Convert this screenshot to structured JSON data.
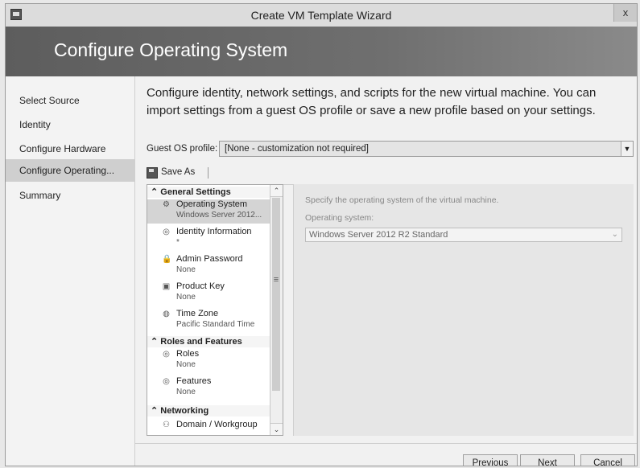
{
  "window": {
    "title": "Create VM Template Wizard",
    "close_glyph": "x"
  },
  "banner": {
    "title": "Configure Operating System"
  },
  "nav": {
    "items": [
      {
        "label": "Select Source"
      },
      {
        "label": "Identity"
      },
      {
        "label": "Configure Hardware"
      },
      {
        "label": "Configure Operating..."
      },
      {
        "label": "Summary"
      }
    ],
    "active_index": 3
  },
  "main": {
    "description": "Configure identity, network settings, and scripts for the new virtual machine. You can import settings from a guest OS profile or save a new profile based on your settings.",
    "guest_os_profile": {
      "label": "Guest OS profile:",
      "value": "[None - customization not required]"
    },
    "toolbar": {
      "save_as_label": "Save As"
    }
  },
  "tree": {
    "general_settings": "General Settings",
    "os": {
      "title": "Operating System",
      "value": "Windows Server 2012..."
    },
    "identity": {
      "title": "Identity Information",
      "value": "*"
    },
    "admin": {
      "title": "Admin Password",
      "value": "None"
    },
    "product": {
      "title": "Product Key",
      "value": "None"
    },
    "timezone": {
      "title": "Time Zone",
      "value": "Pacific Standard Time"
    },
    "roles_features": "Roles and Features",
    "roles": {
      "title": "Roles",
      "value": "None"
    },
    "features": {
      "title": "Features",
      "value": "None"
    },
    "networking": "Networking",
    "domain": {
      "title": "Domain / Workgroup"
    }
  },
  "detail": {
    "description": "Specify the operating system of the virtual machine.",
    "os_label": "Operating system:",
    "os_value": "Windows Server 2012 R2 Standard"
  },
  "footer": {
    "previous": "Previous",
    "next": "Next",
    "cancel": "Cancel"
  }
}
